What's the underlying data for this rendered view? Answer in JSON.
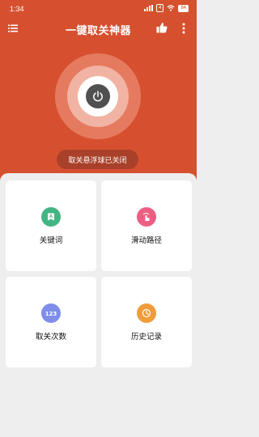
{
  "status_bar": {
    "time": "1:34",
    "chip1": "5G",
    "chip2": "4",
    "battery": "84"
  },
  "toolbar": {
    "title": "一键取关神器"
  },
  "power": {
    "status_text": "取关悬浮球已关闭"
  },
  "features": [
    {
      "label": "关键词",
      "icon": "keyword-icon",
      "color": "#43b582"
    },
    {
      "label": "滑动路径",
      "icon": "swipe-icon",
      "color": "#ec5f83"
    },
    {
      "label": "取关次数",
      "icon": "counter-icon",
      "color": "#7e8ee9"
    },
    {
      "label": "历史记录",
      "icon": "history-icon",
      "color": "#f19c3a"
    }
  ],
  "colors": {
    "header": "#d6502f",
    "power_button": "#505050",
    "background": "#eeeeee"
  }
}
